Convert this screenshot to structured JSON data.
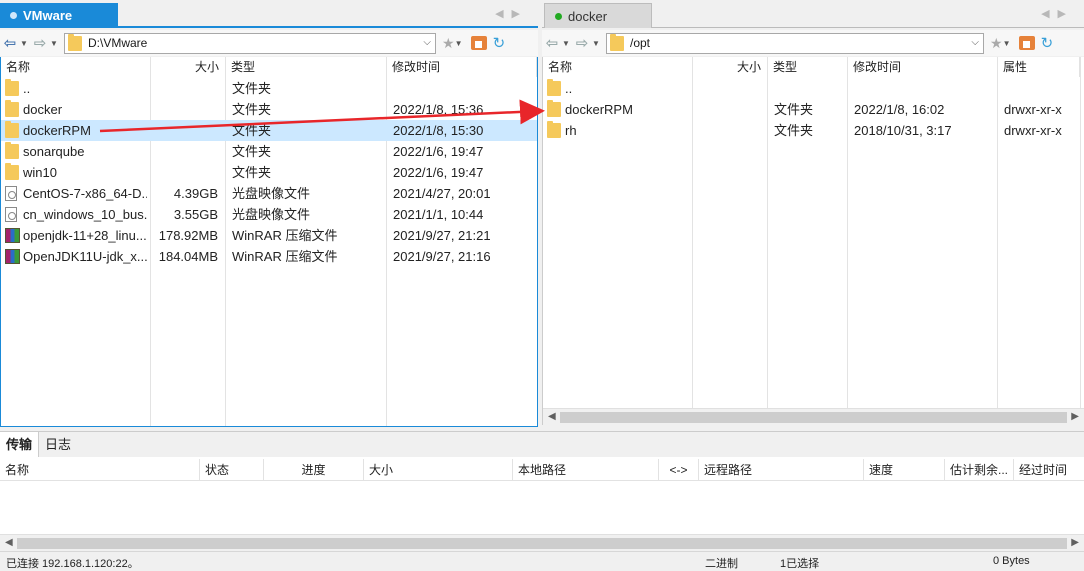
{
  "left": {
    "tab_label": "VMware",
    "path": "D:\\VMware",
    "columns": [
      "名称",
      "大小",
      "类型",
      "修改时间"
    ],
    "files": [
      {
        "name": "..",
        "size": "",
        "type": "文件夹",
        "modified": "",
        "icon": "folder"
      },
      {
        "name": "docker",
        "size": "",
        "type": "文件夹",
        "modified": "2022/1/8, 15:36",
        "icon": "folder"
      },
      {
        "name": "dockerRPM",
        "size": "",
        "type": "文件夹",
        "modified": "2022/1/8, 15:30",
        "icon": "folder"
      },
      {
        "name": "sonarqube",
        "size": "",
        "type": "文件夹",
        "modified": "2022/1/6, 19:47",
        "icon": "folder"
      },
      {
        "name": "win10",
        "size": "",
        "type": "文件夹",
        "modified": "2022/1/6, 19:47",
        "icon": "folder"
      },
      {
        "name": "CentOS-7-x86_64-D...",
        "size": "4.39GB",
        "type": "光盘映像文件",
        "modified": "2021/4/27, 20:01",
        "icon": "iso"
      },
      {
        "name": "cn_windows_10_bus...",
        "size": "3.55GB",
        "type": "光盘映像文件",
        "modified": "2021/1/1, 10:44",
        "icon": "iso"
      },
      {
        "name": "openjdk-11+28_linu...",
        "size": "178.92MB",
        "type": "WinRAR 压缩文件",
        "modified": "2021/9/27, 21:21",
        "icon": "rar"
      },
      {
        "name": "OpenJDK11U-jdk_x...",
        "size": "184.04MB",
        "type": "WinRAR 压缩文件",
        "modified": "2021/9/27, 21:16",
        "icon": "rar"
      }
    ]
  },
  "right": {
    "tab_label": "docker",
    "tab_status_color": "#22aa22",
    "path": "/opt",
    "columns": [
      "名称",
      "大小",
      "类型",
      "修改时间",
      "属性"
    ],
    "files": [
      {
        "name": "..",
        "size": "",
        "type": "",
        "modified": "",
        "attrs": "",
        "icon": "folder"
      },
      {
        "name": "dockerRPM",
        "size": "",
        "type": "文件夹",
        "modified": "2022/1/8, 16:02",
        "attrs": "drwxr-xr-x",
        "icon": "folder"
      },
      {
        "name": "rh",
        "size": "",
        "type": "文件夹",
        "modified": "2018/10/31, 3:17",
        "attrs": "drwxr-xr-x",
        "icon": "folder"
      }
    ]
  },
  "transfer": {
    "tabs": [
      "传输",
      "日志"
    ],
    "columns": [
      "名称",
      "状态",
      "进度",
      "大小",
      "本地路径",
      "<->",
      "远程路径",
      "速度",
      "估计剩余...",
      "经过时间"
    ]
  },
  "status": {
    "connection": "已连接 192.168.1.120:22。",
    "mode": "二进制",
    "selection": "1已选择",
    "bytes": "0 Bytes"
  },
  "colors": {
    "accent": "#1a8ad8",
    "selected_row": "#cce8ff",
    "arrow": "#e8262a"
  }
}
